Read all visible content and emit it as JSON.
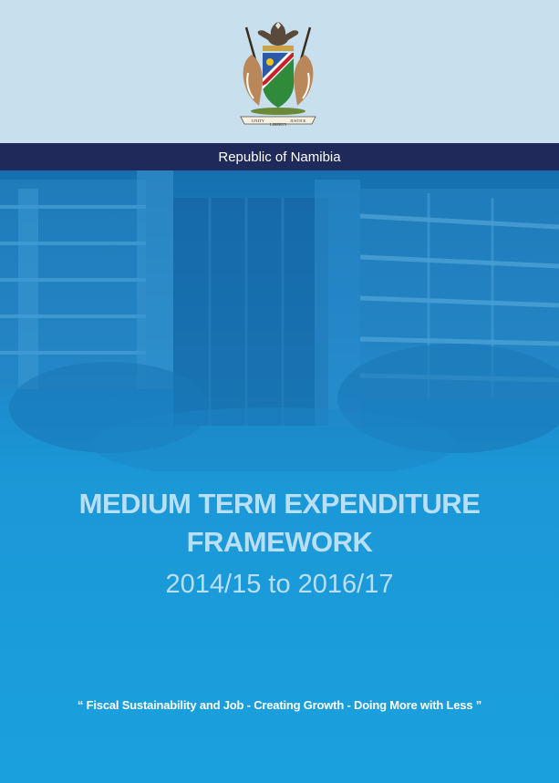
{
  "cover": {
    "crest": {
      "icon": "namibia-coat-of-arms-icon",
      "scroll_left": "UNITY",
      "scroll_center": "LIBERTY",
      "scroll_right": "JUSTICE"
    },
    "banner_text": "Republic of Namibia",
    "title_line1": "MEDIUM TERM EXPENDITURE",
    "title_line2": "FRAMEWORK",
    "period": "2014/15 to 2016/17",
    "motto": "“ Fiscal Sustainability and Job - Creating Growth - Doing More with Less ”"
  },
  "colors": {
    "top_band": "#c8dfee",
    "banner": "#1f2a5a",
    "main_blue": "#1b97d6",
    "title_text": "#b9dff4",
    "motto_text": "#ffffff"
  }
}
